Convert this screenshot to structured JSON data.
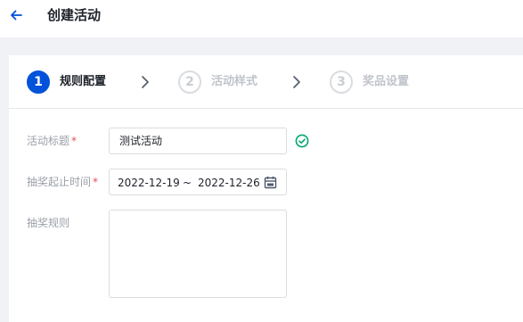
{
  "header": {
    "title": "创建活动",
    "back_icon": "arrow-left-icon"
  },
  "steps": [
    {
      "number": "1",
      "label": "规则配置",
      "state": "active"
    },
    {
      "number": "2",
      "label": "活动样式",
      "state": "inactive"
    },
    {
      "number": "3",
      "label": "奖品设置",
      "state": "inactive"
    }
  ],
  "form": {
    "title_field": {
      "label": "活动标题",
      "required_mark": "*",
      "value": "测试活动",
      "status_icon": "check-circle-icon"
    },
    "time_field": {
      "label": "抽奖起止时间",
      "required_mark": "*",
      "start": "2022-12-19",
      "separator": "~",
      "end": "2022-12-26",
      "icon": "calendar-icon"
    },
    "rules_field": {
      "label": "抽奖规则",
      "value": ""
    }
  },
  "colors": {
    "primary": "#0052d9",
    "success": "#00a870",
    "required": "#e34d59"
  }
}
